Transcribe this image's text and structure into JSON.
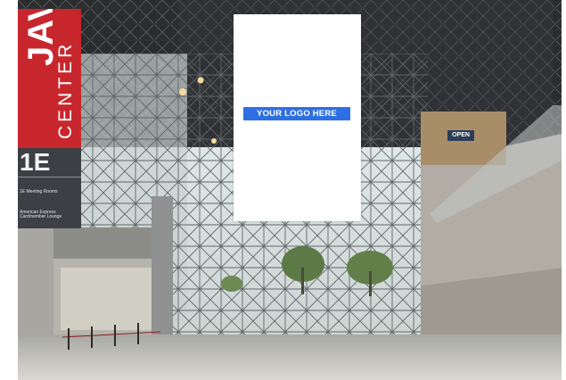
{
  "scene": {
    "description_icon": "photo-icon"
  },
  "banner": {
    "logo_text": "YOUR LOGO HERE",
    "accent": "#2f6fe4"
  },
  "signage": {
    "main_word": "JAVITS",
    "sub_word": "CENTER",
    "hall": "1E",
    "line1": "1E Meeting Rooms",
    "line2": "",
    "line3": "American Express Cardmember Lounge",
    "brand_color": "#c8262d"
  },
  "wall_sign": {
    "label": "OPEN"
  }
}
